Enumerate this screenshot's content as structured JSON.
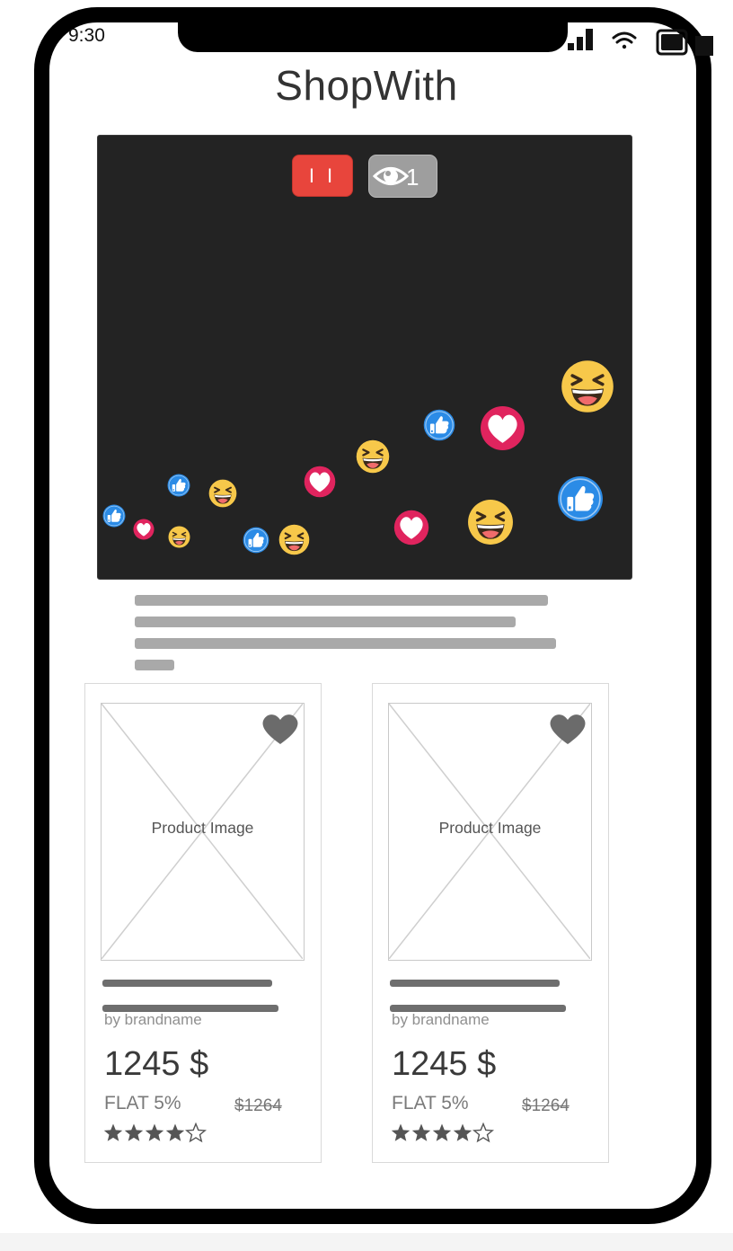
{
  "status_bar": {
    "time": "9:30",
    "icons": [
      "signal-icon",
      "wifi-icon",
      "battery-icon"
    ]
  },
  "app": {
    "title": "ShopWith"
  },
  "live_video": {
    "pause_label": "I I",
    "viewers_icon": "eye-icon",
    "viewers_count": "1",
    "reactions": [
      "like-icon",
      "heart-icon",
      "laugh-icon"
    ],
    "colors": {
      "pause": "#e8453c",
      "like": "#2b8be6",
      "heart": "#e0245e",
      "laugh": "#f7c84a"
    }
  },
  "products": [
    {
      "image_label": "Product Image",
      "brand": "by brandname",
      "price": "1245 $",
      "discount": "FLAT 5%",
      "old_price": "$1264",
      "rating": 4,
      "rating_max": 5
    },
    {
      "image_label": "Product Image",
      "brand": "by brandname",
      "price": "1245 $",
      "discount": "FLAT 5%",
      "old_price": "$1264",
      "rating": 4,
      "rating_max": 5
    }
  ]
}
